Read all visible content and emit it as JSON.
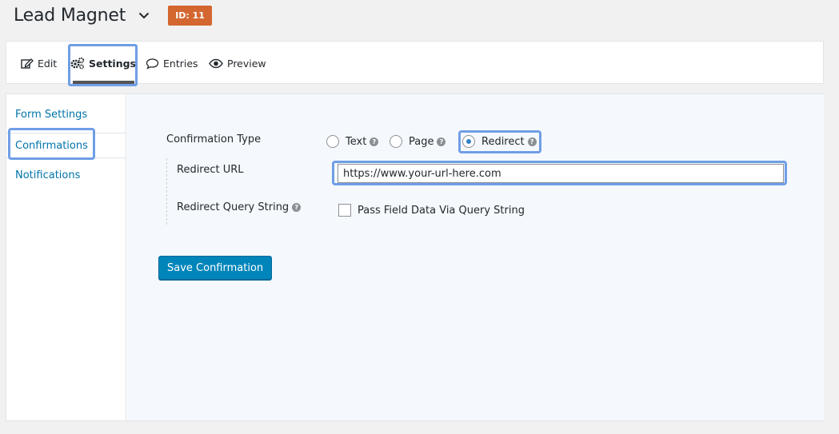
{
  "header": {
    "form_title": "Lead Magnet",
    "id_badge": "ID: 11"
  },
  "toolbar": {
    "edit_label": "Edit",
    "settings_label": "Settings",
    "entries_label": "Entries",
    "preview_label": "Preview",
    "active": "Settings"
  },
  "sidebar": {
    "items": [
      {
        "label": "Form Settings"
      },
      {
        "label": "Confirmations"
      },
      {
        "label": "Notifications"
      }
    ],
    "active": "Confirmations"
  },
  "confirmation": {
    "type_label": "Confirmation Type",
    "options": [
      {
        "label": "Text",
        "checked": false
      },
      {
        "label": "Page",
        "checked": false
      },
      {
        "label": "Redirect",
        "checked": true
      }
    ],
    "redirect_url_label": "Redirect URL",
    "redirect_url_value": "https://www.your-url-here.com",
    "query_string_label": "Redirect Query String",
    "pass_field_label": "Pass Field Data Via Query String",
    "pass_field_checked": false,
    "save_label": "Save Confirmation"
  },
  "colors": {
    "accent": "#0085ba",
    "link": "#0073aa",
    "badge": "#d4662f",
    "highlight": "#6f9ee6"
  },
  "icons": {
    "help": "question-circle-icon",
    "edit": "edit-icon",
    "settings": "gears-icon",
    "entries": "speech-bubble-icon",
    "preview": "eye-icon",
    "title_chevron": "chevron-down-icon"
  }
}
